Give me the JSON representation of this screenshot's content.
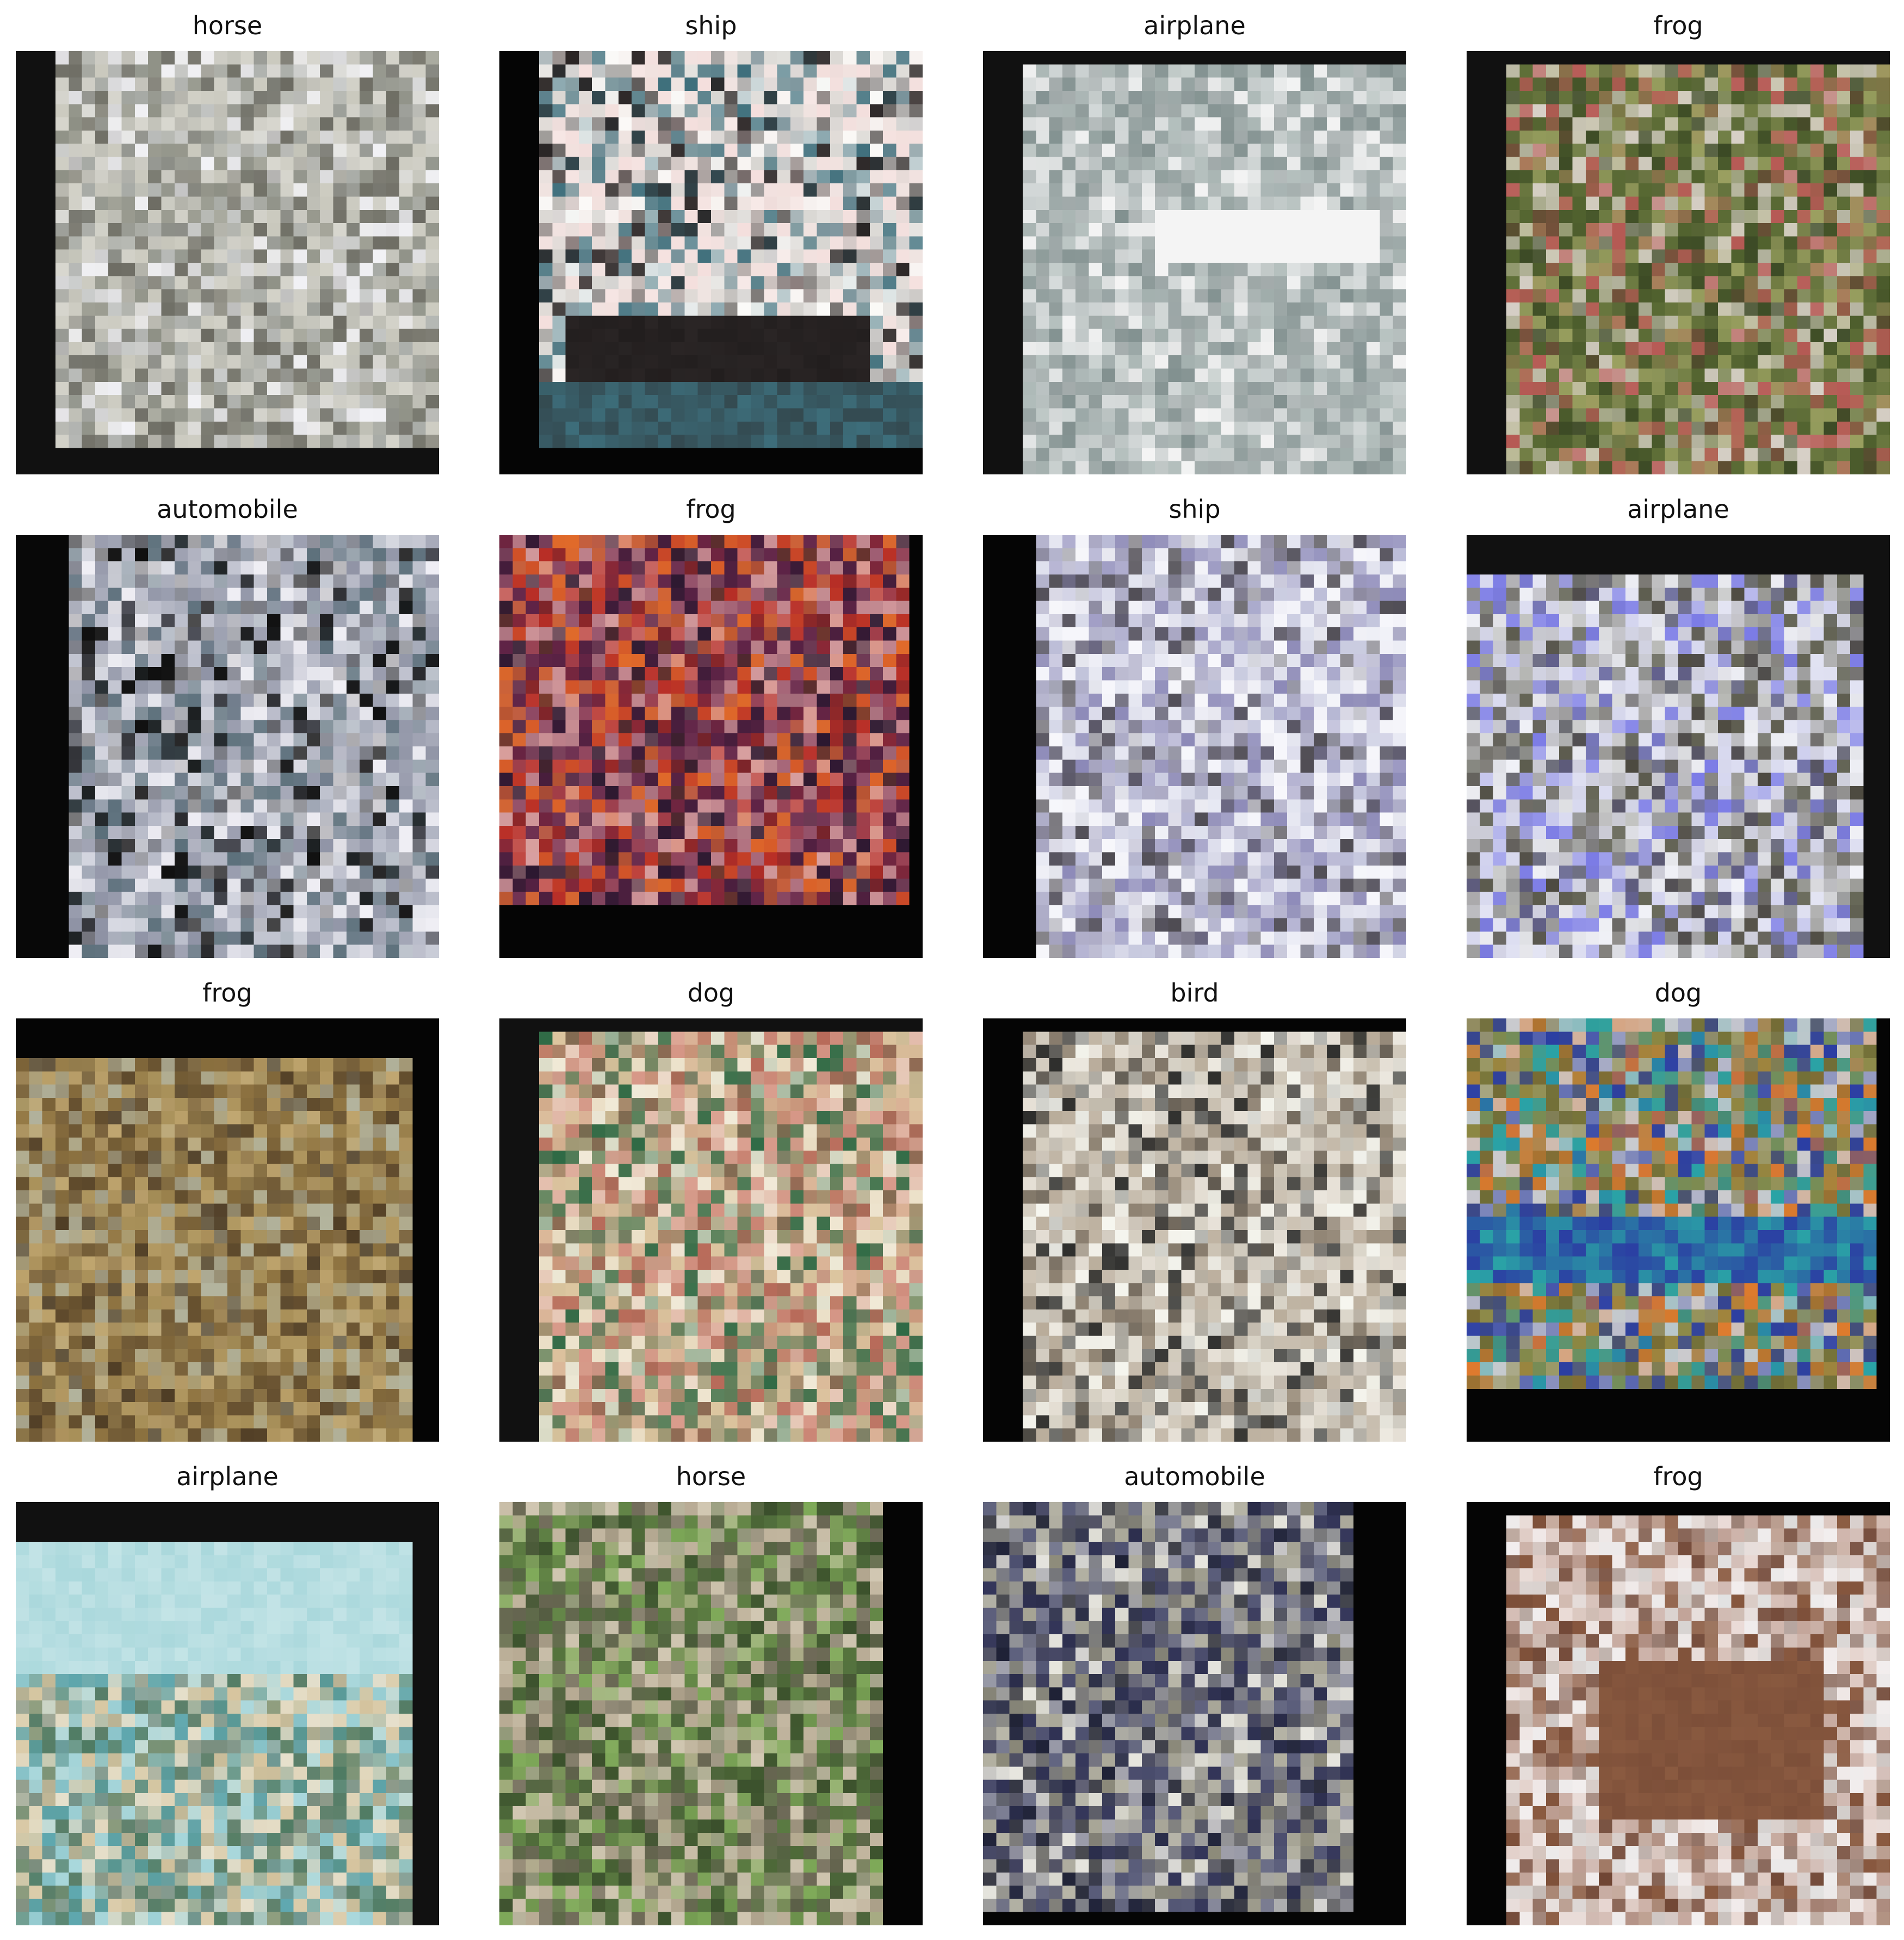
{
  "grid": {
    "items": [
      {
        "title": "horse",
        "pad": "#111111",
        "inset": "left-bottom",
        "colors": [
          "#a7aaa5",
          "#f2f2f6",
          "#d8d7cf",
          "#6c6b62",
          "#8e9085",
          "#c9c8bd"
        ]
      },
      {
        "title": "ship",
        "pad": "#050505",
        "inset": "left-bottom",
        "colors": [
          "#fbfaf8",
          "#efe4e1",
          "#2a2525",
          "#3d6e7b",
          "#f4dfdd",
          "#d8d6d2"
        ]
      },
      {
        "title": "airplane",
        "pad": "#111111",
        "inset": "left-top",
        "colors": [
          "#b6c1bf",
          "#9aa6a5",
          "#f4f4f4",
          "#81908f",
          "#a3abab",
          "#d3d8d8"
        ]
      },
      {
        "title": "frog",
        "pad": "#111111",
        "inset": "left-top",
        "colors": [
          "#6f7d43",
          "#3c4a25",
          "#b75a55",
          "#d7d0c7",
          "#52632f",
          "#9aa060"
        ]
      },
      {
        "title": "automobile",
        "pad": "#050505",
        "inset": "full",
        "colors": [
          "#b5b8c6",
          "#d7d9e2",
          "#101010",
          "#5b6f7a",
          "#8e92a4",
          "#f0eff5"
        ]
      },
      {
        "title": "frog",
        "pad": "#050505",
        "inset": "bottom-right",
        "colors": [
          "#b82e26",
          "#2b1830",
          "#d8a0a0",
          "#e06a2a",
          "#5e2346",
          "#8e4a65"
        ]
      },
      {
        "title": "ship",
        "pad": "#050505",
        "inset": "left",
        "colors": [
          "#eeeff7",
          "#c9cbe0",
          "#4f4c53",
          "#8c89b8",
          "#f7f7fb",
          "#a8a6c2"
        ]
      },
      {
        "title": "airplane",
        "pad": "#111111",
        "inset": "top-right",
        "colors": [
          "#7c7ce6",
          "#f1f2f8",
          "#c6c6cc",
          "#6a6b5b",
          "#4d4a40",
          "#d8d9ef"
        ]
      },
      {
        "title": "frog",
        "pad": "#050505",
        "inset": "top-right",
        "colors": [
          "#8f7441",
          "#6d5633",
          "#a78f58",
          "#4f3d25",
          "#c0a66f",
          "#b3b49e"
        ]
      },
      {
        "title": "dog",
        "pad": "#111111",
        "inset": "left-top",
        "colors": [
          "#f1ead8",
          "#2f6a45",
          "#dcc6a0",
          "#d89a8a",
          "#a09874",
          "#b86b5a"
        ]
      },
      {
        "title": "bird",
        "pad": "#050505",
        "inset": "left-top",
        "colors": [
          "#f6f6ef",
          "#ddd8cc",
          "#8d8171",
          "#2e2e2c",
          "#b9ac9a",
          "#e6e0d6"
        ]
      },
      {
        "title": "dog",
        "pad": "#050505",
        "inset": "bottom-right",
        "colors": [
          "#8a8743",
          "#cbcbcf",
          "#e07b2d",
          "#2aa3a6",
          "#2b3ea3",
          "#6e6b36"
        ]
      },
      {
        "title": "airplane",
        "pad": "#111111",
        "inset": "top-right",
        "colors": [
          "#aad8dc",
          "#e6e0cc",
          "#5fa8b0",
          "#4f7b63",
          "#d7c59f",
          "#7c8d7d"
        ]
      },
      {
        "title": "horse",
        "pad": "#050505",
        "inset": "right",
        "colors": [
          "#4a6538",
          "#b8ab94",
          "#7faa59",
          "#6f6a58",
          "#d2c8b3",
          "#3a4f2b"
        ]
      },
      {
        "title": "automobile",
        "pad": "#050505",
        "inset": "right-bottom",
        "colors": [
          "#34365a",
          "#b9b7a9",
          "#1d2035",
          "#8d8b7a",
          "#5c5f7c",
          "#e7e6df"
        ]
      },
      {
        "title": "frog",
        "pad": "#050505",
        "inset": "left-top",
        "colors": [
          "#eadbd6",
          "#e3e3e3",
          "#8a5a40",
          "#c4a69b",
          "#6f4432",
          "#f2eeee"
        ]
      }
    ]
  }
}
